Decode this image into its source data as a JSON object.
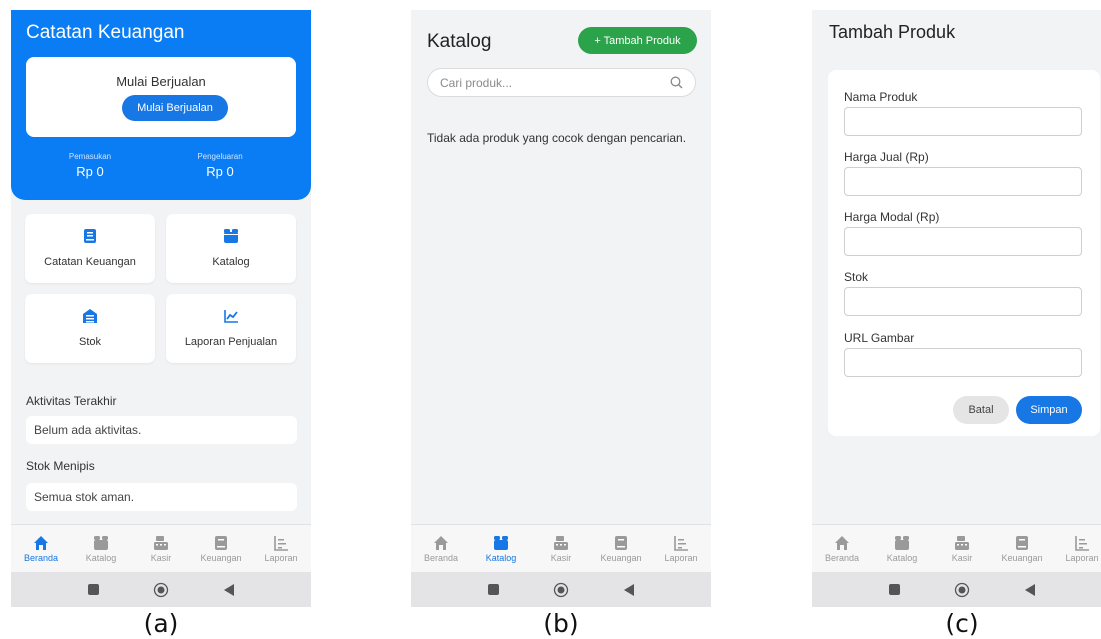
{
  "colors": {
    "primary": "#0a7cf4",
    "accent": "#1677e5",
    "success": "#2aa34a",
    "inactive": "#9a9a9a"
  },
  "nav": {
    "items": [
      {
        "label": "Beranda",
        "icon": "home-icon"
      },
      {
        "label": "Katalog",
        "icon": "box-icon"
      },
      {
        "label": "Kasir",
        "icon": "cash-register-icon"
      },
      {
        "label": "Keuangan",
        "icon": "book-icon"
      },
      {
        "label": "Laporan",
        "icon": "chart-icon"
      }
    ]
  },
  "captions": {
    "a": "(a)",
    "b": "(b)",
    "c": "(c)"
  },
  "home": {
    "title": "Catatan Keuangan",
    "card": {
      "title": "Mulai Berjualan",
      "button": "Mulai Berjualan"
    },
    "income": {
      "label": "Pemasukan",
      "value": "Rp 0"
    },
    "expense": {
      "label": "Pengeluaran",
      "value": "Rp 0"
    },
    "tiles": [
      {
        "label": "Catatan Keuangan",
        "icon": "book-icon"
      },
      {
        "label": "Katalog",
        "icon": "box-icon"
      },
      {
        "label": "Stok",
        "icon": "warehouse-icon"
      },
      {
        "label": "Laporan Penjualan",
        "icon": "line-chart-icon"
      }
    ],
    "recent_title": "Aktivitas Terakhir",
    "recent_empty": "Belum ada aktivitas.",
    "low_stock_title": "Stok Menipis",
    "low_stock_empty": "Semua stok aman."
  },
  "catalog": {
    "title": "Katalog",
    "add_button": "+ Tambah Produk",
    "search_placeholder": "Cari produk...",
    "empty_message": "Tidak ada produk yang cocok dengan pencarian."
  },
  "add_product": {
    "title": "Tambah Produk",
    "fields": [
      {
        "label": "Nama Produk",
        "value": ""
      },
      {
        "label": "Harga Jual (Rp)",
        "value": ""
      },
      {
        "label": "Harga Modal (Rp)",
        "value": ""
      },
      {
        "label": "Stok",
        "value": ""
      },
      {
        "label": "URL Gambar",
        "value": ""
      }
    ],
    "cancel_button": "Batal",
    "save_button": "Simpan"
  }
}
